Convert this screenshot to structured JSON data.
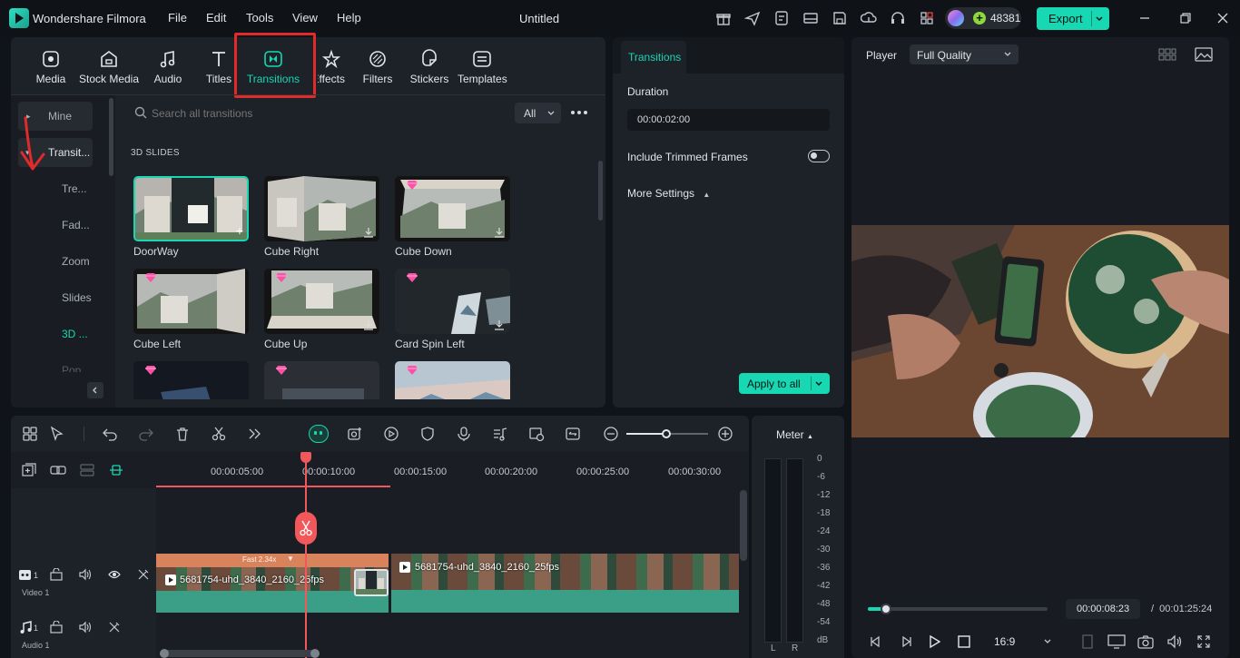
{
  "app": {
    "name": "Wondershare Filmora",
    "document_title": "Untitled",
    "credits": "48381"
  },
  "menu": [
    "File",
    "Edit",
    "Tools",
    "View",
    "Help"
  ],
  "export_label": "Export",
  "media_tabs": [
    "Media",
    "Stock Media",
    "Audio",
    "Titles",
    "Transitions",
    "Effects",
    "Filters",
    "Stickers",
    "Templates"
  ],
  "sidebar": {
    "mine": "Mine",
    "transitions": "Transit...",
    "items": [
      "Tre...",
      "Fad...",
      "Zoom",
      "Slides",
      "3D ...",
      "Pop"
    ]
  },
  "search": {
    "placeholder": "Search all transitions",
    "filter": "All"
  },
  "section_title": "3D SLIDES",
  "transitions": [
    {
      "name": "DoorWay",
      "premium": false,
      "selected": true
    },
    {
      "name": "Cube Right",
      "premium": false
    },
    {
      "name": "Cube Down",
      "premium": true
    },
    {
      "name": "Cube Left",
      "premium": true
    },
    {
      "name": "Cube Up",
      "premium": true
    },
    {
      "name": "Card Spin Left",
      "premium": true
    },
    {
      "name": "",
      "premium": true
    },
    {
      "name": "",
      "premium": true
    },
    {
      "name": "",
      "premium": true
    }
  ],
  "properties": {
    "tab": "Transitions",
    "duration_label": "Duration",
    "duration_value": "00:00:02:00",
    "include_trimmed": "Include Trimmed Frames",
    "more_settings": "More Settings",
    "apply_all": "Apply to all"
  },
  "player": {
    "label": "Player",
    "quality": "Full Quality",
    "current_time": "00:00:08:23",
    "total_time": "00:01:25:24",
    "aspect": "16:9",
    "progress": 0.1
  },
  "timeline": {
    "ruler": [
      "00:00:05:00",
      "00:00:10:00",
      "00:00:15:00",
      "00:00:20:00",
      "00:00:25:00",
      "00:00:30:00"
    ],
    "speed_label": "Fast 2.34x",
    "clip1": "5681754-uhd_3840_2160_25fps",
    "clip2": "5681754-uhd_3840_2160_25fps",
    "video_track": "Video 1",
    "audio_track": "Audio 1",
    "track_num": "1"
  },
  "meter": {
    "label": "Meter",
    "scale": [
      "0",
      "-6",
      "-12",
      "-18",
      "-24",
      "-30",
      "-36",
      "-42",
      "-48",
      "-54",
      "dB"
    ],
    "left": "L",
    "right": "R"
  },
  "colors": {
    "accent": "#18d7b3",
    "playhead": "#f0585c",
    "clip": "#3a9f86",
    "speed_bar": "#d9835c",
    "highlight": "#e12a2a"
  }
}
